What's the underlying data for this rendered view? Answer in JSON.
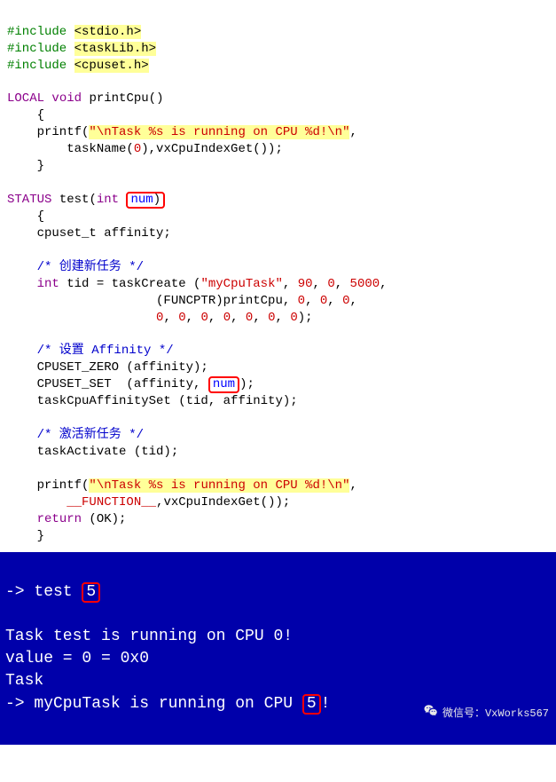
{
  "code": {
    "inc1_dir": "#include",
    "inc1_arg": "<stdio.h>",
    "inc2_dir": "#include",
    "inc2_arg": "<taskLib.h>",
    "inc3_dir": "#include",
    "inc3_arg": "<cpuset.h>",
    "local": "LOCAL",
    "void": "void",
    "printCpu": "printCpu",
    "lparen": "(",
    "rparen": ")",
    "lbrace": "    {",
    "printf1a": "    printf(",
    "printf1b": "\"\\nTask %s is running on CPU %d!\\n\"",
    "printf1c": ",",
    "printf2a": "        taskName(",
    "printf2_n0": "0",
    "printf2b": "),vxCpuIndexGet());",
    "rbrace": "    }",
    "status": "STATUS",
    "test": "test",
    "int": "int",
    "num": "num",
    "lbrace2": "    {",
    "cpuset_decl": "    cpuset_t affinity;",
    "cmt1": "    /* 创建新任务 */",
    "tid1a": "    ",
    "tid_int": "int",
    "tid1b": " tid = taskCreate (",
    "tid1c": "\"myCpuTask\"",
    "tid1d": ", ",
    "tid_n90": "90",
    "tid1e": ", ",
    "tid_n0a": "0",
    "tid1f": ", ",
    "tid_n5000": "5000",
    "tid1g": ",",
    "tid2a": "                    (FUNCPTR)printCpu, ",
    "tid_n0b": "0",
    "tid_n0c": "0",
    "tid_n0d": "0",
    "tid3a": "                    ",
    "tid_n0s": "0",
    "tid3b": ");",
    "cmt2": "    /* 设置 Affinity */",
    "cz": "    CPUSET_ZERO (affinity);",
    "cs_a": "    CPUSET_SET  (affinity, ",
    "cs_num": "num",
    "cs_b": ");",
    "tas": "    taskCpuAffinitySet (tid, affinity);",
    "cmt3": "    /* 激活新任务 */",
    "activate": "    taskActivate (tid);",
    "printf3a": "    printf(",
    "printf3b": "\"\\nTask %s is running on CPU %d!\\n\"",
    "printf3c": ",",
    "printf4a": "        ",
    "func_macro": "__FUNCTION__",
    "printf4b": ",vxCpuIndexGet());",
    "return_a": "    ",
    "return_kw": "return",
    "return_b": " (OK);",
    "rbrace2": "    }"
  },
  "terminal": {
    "prompt1a": "-> test ",
    "prompt1b": "5",
    "blank": "",
    "line2": "Task test is running on CPU 0!",
    "line3": "value = 0 = 0x0",
    "line4": "Task",
    "line5a": "-> myCpuTask is running on CPU ",
    "line5b": "5",
    "line5c": "!"
  },
  "watermark": "微信号：VxWorks567"
}
